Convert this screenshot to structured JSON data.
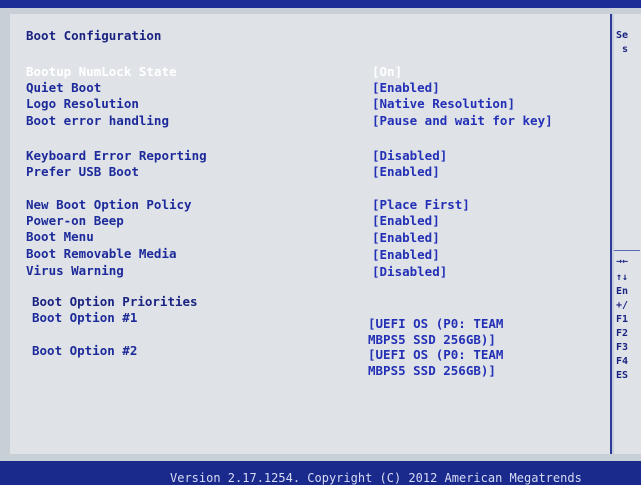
{
  "section": {
    "title": "Boot Configuration"
  },
  "settings": [
    {
      "label": "Bootup NumLock State",
      "value": "[On]"
    },
    {
      "label": "Quiet Boot",
      "value": "[Enabled]"
    },
    {
      "label": "Logo Resolution",
      "value": "[Native Resolution]"
    },
    {
      "label": "Boot error handling",
      "value": "[Pause and wait for key]"
    },
    {
      "label": "Keyboard Error Reporting",
      "value": "[Disabled]"
    },
    {
      "label": "Prefer USB Boot",
      "value": "[Enabled]"
    },
    {
      "label": "New Boot Option Policy",
      "value": "[Place First]"
    },
    {
      "label": "Power-on Beep",
      "value": "[Enabled]"
    },
    {
      "label": "Boot Menu",
      "value": "[Enabled]"
    },
    {
      "label": "Boot Removable Media",
      "value": "[Enabled]"
    },
    {
      "label": "Virus Warning",
      "value": "[Disabled]"
    }
  ],
  "boot_priorities": {
    "title": "Boot Option Priorities",
    "options": [
      {
        "label": "Boot Option #1",
        "value_line1": "[UEFI OS (P0: TEAM",
        "value_line2": "MBPS5 SSD 256GB)]"
      },
      {
        "label": "Boot Option #2",
        "value_line1": "[UEFI OS (P0: TEAM",
        "value_line2": "MBPS5 SSD 256GB)]"
      }
    ]
  },
  "help_panel": {
    "top": [
      "Se",
      "s"
    ],
    "keys": [
      "→←",
      "↑↓",
      "En",
      "+/",
      "F1",
      "F2",
      "F3",
      "F4",
      "ES"
    ]
  },
  "footer": {
    "text": "Version 2.17.1254. Copyright (C) 2012 American Megatrends"
  },
  "colors": {
    "background": "#1a2a8c",
    "panel": "#dfe3e8",
    "label": "#1d2a9a",
    "value": "#2330b5",
    "selected": "#ffffff"
  }
}
